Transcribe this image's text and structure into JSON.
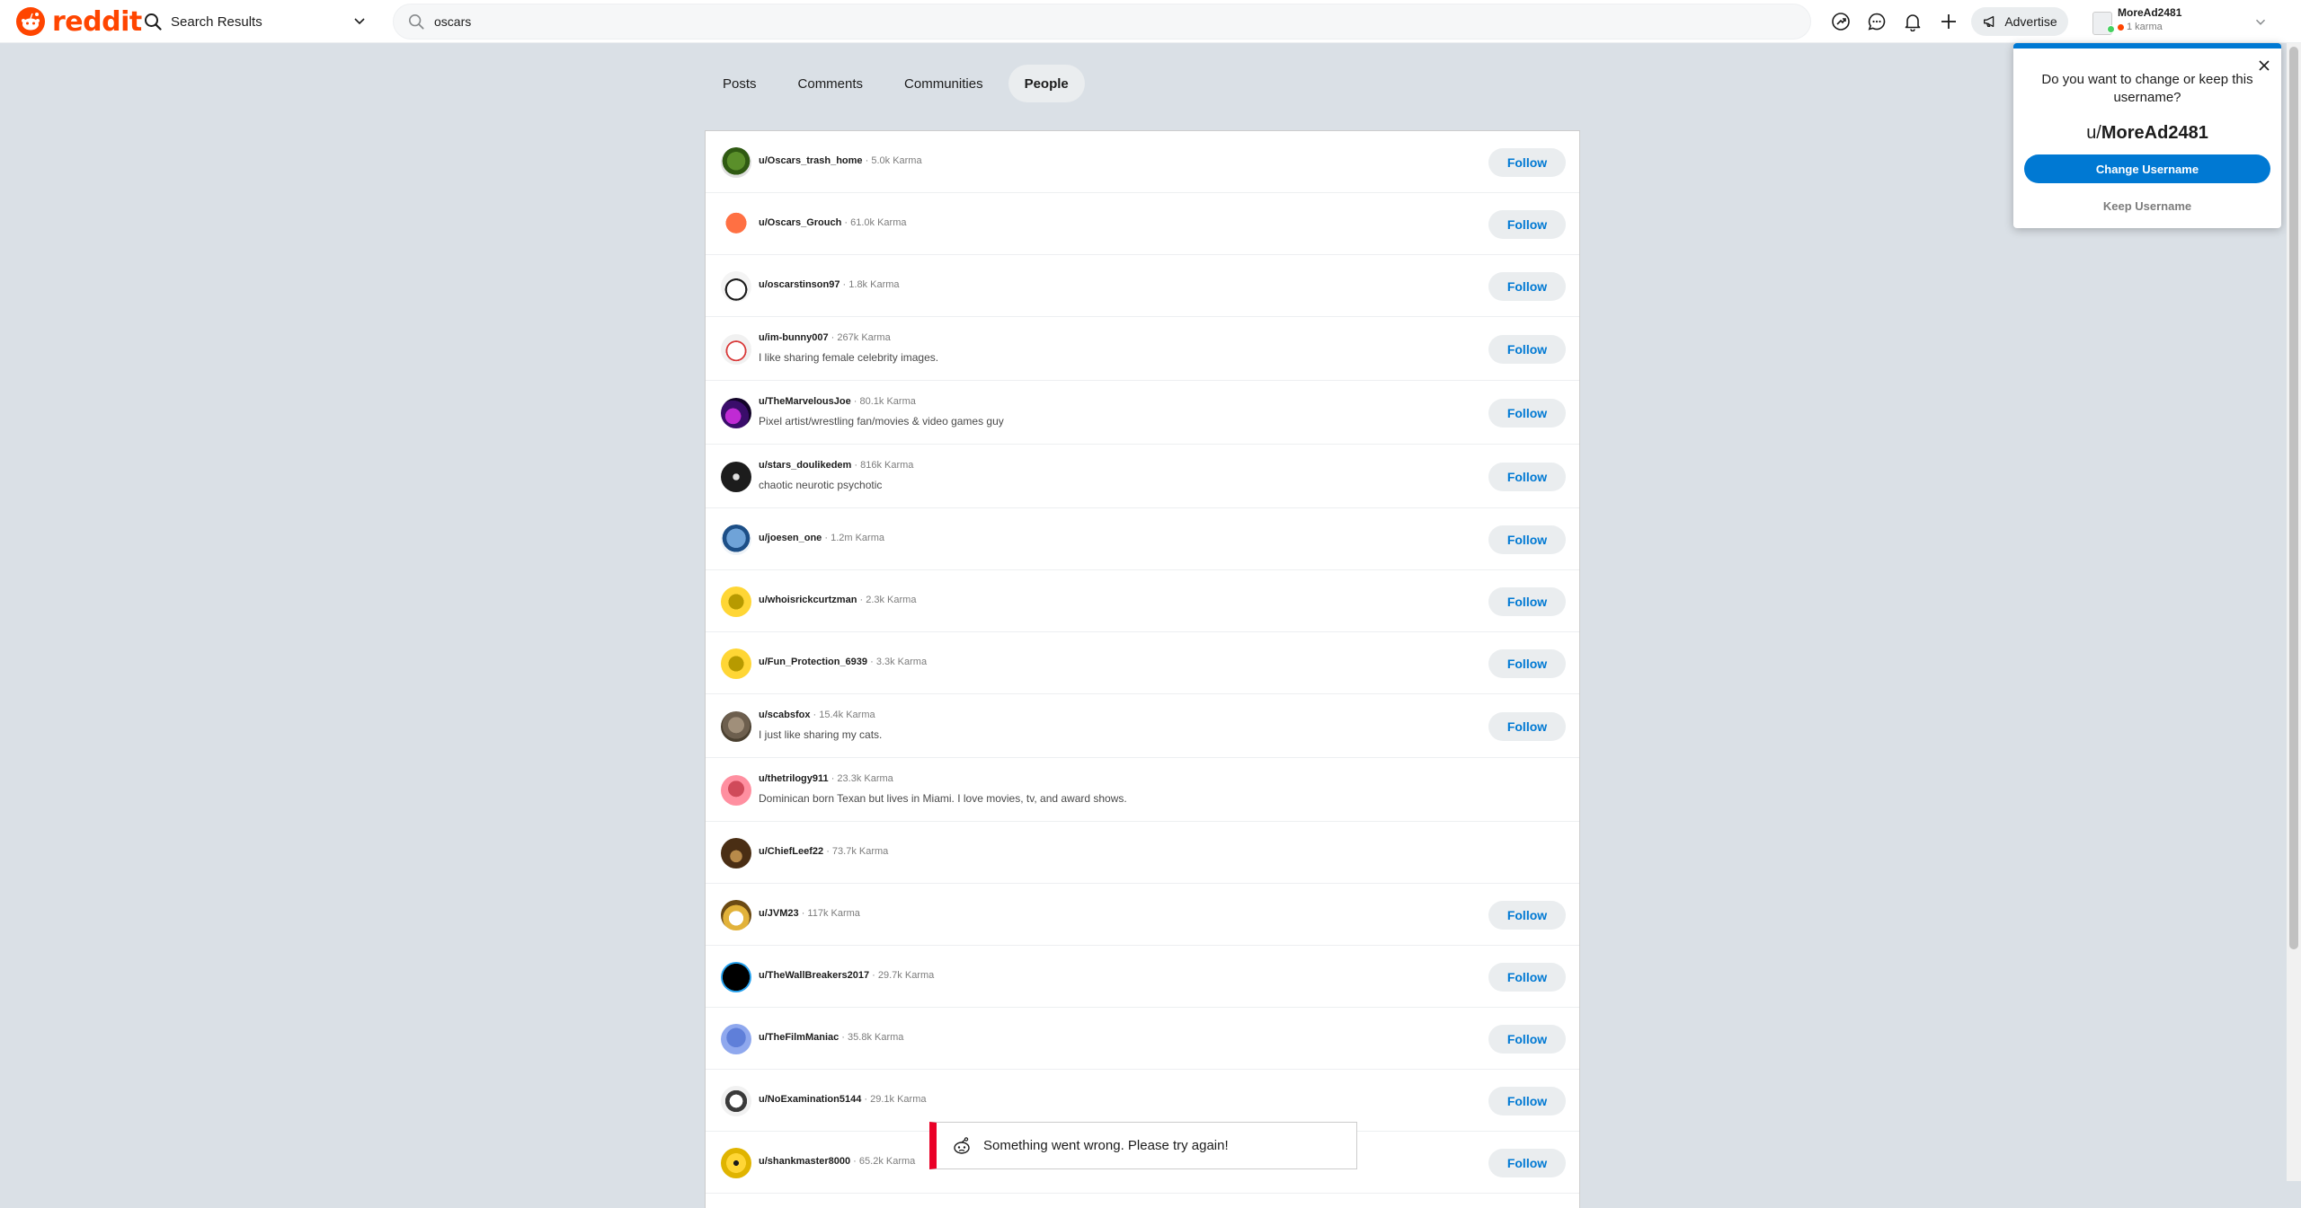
{
  "header": {
    "logo_text": "reddit",
    "nav_dropdown_label": "Search Results",
    "search_value": "oscars",
    "advertise_label": "Advertise",
    "username": "MoreAd2481",
    "karma_label": "1 karma"
  },
  "tabs": [
    {
      "label": "Posts"
    },
    {
      "label": "Comments"
    },
    {
      "label": "Communities"
    },
    {
      "label": "People",
      "active": true
    }
  ],
  "follow_label": "Follow",
  "people": [
    {
      "username": "u/Oscars_trash_home",
      "karma": "5.0k Karma",
      "bio": "",
      "follow": true,
      "avatar": "green-snoo"
    },
    {
      "username": "u/Oscars_Grouch",
      "karma": "61.0k Karma",
      "bio": "",
      "follow": true,
      "avatar": "orange-snoo"
    },
    {
      "username": "u/oscarstinson97",
      "karma": "1.8k Karma",
      "bio": "",
      "follow": true,
      "avatar": "white-snoo-cap"
    },
    {
      "username": "u/im-bunny007",
      "karma": "267k Karma",
      "bio": "I like sharing female celebrity images.",
      "follow": true,
      "avatar": "white-snoo-red"
    },
    {
      "username": "u/TheMarvelousJoe",
      "karma": "80.1k Karma",
      "bio": "Pixel artist/wrestling fan/movies & video games guy",
      "follow": true,
      "avatar": "purple-photo"
    },
    {
      "username": "u/stars_doulikedem",
      "karma": "816k Karma",
      "bio": "chaotic neurotic psychotic",
      "follow": true,
      "avatar": "dark-photo"
    },
    {
      "username": "u/joesen_one",
      "karma": "1.2m Karma",
      "bio": "",
      "follow": true,
      "avatar": "blue-snoo"
    },
    {
      "username": "u/whoisrickcurtzman",
      "karma": "2.3k Karma",
      "bio": "",
      "follow": true,
      "avatar": "yellow-snoo"
    },
    {
      "username": "u/Fun_Protection_6939",
      "karma": "3.3k Karma",
      "bio": "",
      "follow": true,
      "avatar": "yellow-snoo"
    },
    {
      "username": "u/scabsfox",
      "karma": "15.4k Karma",
      "bio": "I just like sharing my cats.",
      "follow": true,
      "avatar": "cat-photo"
    },
    {
      "username": "u/thetrilogy911",
      "karma": "23.3k Karma",
      "bio": "Dominican born Texan but lives in Miami. I love movies, tv, and award shows.",
      "follow": false,
      "avatar": "pink-snoo"
    },
    {
      "username": "u/ChiefLeef22",
      "karma": "73.7k Karma",
      "bio": "",
      "follow": false,
      "avatar": "brown-photo"
    },
    {
      "username": "u/JVM23",
      "karma": "117k Karma",
      "bio": "",
      "follow": true,
      "avatar": "yellow-hat-snoo"
    },
    {
      "username": "u/TheWallBreakers2017",
      "karma": "29.7k Karma",
      "bio": "",
      "follow": true,
      "avatar": "black-circle"
    },
    {
      "username": "u/TheFilmManiac",
      "karma": "35.8k Karma",
      "bio": "",
      "follow": true,
      "avatar": "periwinkle-snoo"
    },
    {
      "username": "u/NoExamination5144",
      "karma": "29.1k Karma",
      "bio": "",
      "follow": true,
      "avatar": "white-snoo-dark"
    },
    {
      "username": "u/shankmaster8000",
      "karma": "65.2k Karma",
      "bio": "",
      "follow": true,
      "avatar": "yellow-glasses-snoo"
    }
  ],
  "popup": {
    "question": "Do you want to change or keep this username?",
    "prefix": "u/",
    "username": "MoreAd2481",
    "change_label": "Change Username",
    "keep_label": "Keep Username"
  },
  "toast": {
    "message": "Something went wrong. Please try again!"
  },
  "colors": {
    "brand": "#ff4500",
    "link_blue": "#0079d3",
    "error_red": "#ea0027",
    "page_bg": "#dae0e6"
  },
  "icons": [
    "reddit-logo-icon",
    "search-icon",
    "chevron-down-icon",
    "popular-icon",
    "chat-icon",
    "bell-icon",
    "plus-icon",
    "megaphone-icon",
    "close-icon",
    "error-snoo-icon"
  ]
}
